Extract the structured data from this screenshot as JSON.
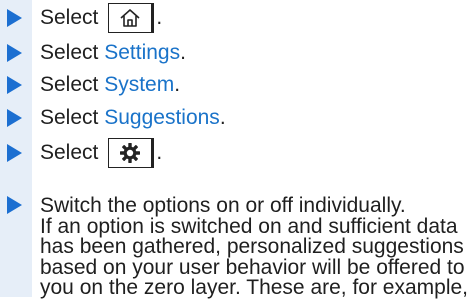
{
  "steps": [
    {
      "prefix": "Select",
      "icon": "home-icon",
      "suffix": "."
    },
    {
      "prefix": "Select",
      "link": "Settings",
      "suffix": "."
    },
    {
      "prefix": "Select",
      "link": "System",
      "suffix": "."
    },
    {
      "prefix": "Select",
      "link": "Suggestions",
      "suffix": "."
    },
    {
      "prefix": "Select",
      "icon": "gear-icon",
      "suffix": "."
    }
  ],
  "final_step": {
    "lines": [
      "Switch the options on or off individually.",
      "If an option is switched on and sufficient data",
      "has been gathered, personalized suggestions",
      "based on your user behavior will be offered to",
      "you on the zero layer. These are, for example,"
    ]
  },
  "colors": {
    "arrow": "#1c6fd1",
    "link": "#1a73c9",
    "gutter": "#e6eef8"
  }
}
